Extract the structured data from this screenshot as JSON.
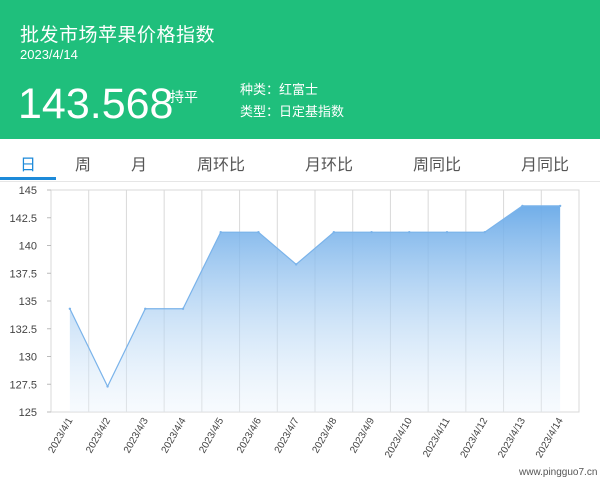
{
  "header": {
    "title": "批发市场苹果价格指数",
    "date": "2023/4/14",
    "value": "143.568",
    "trend": "持平",
    "variety": "种类：红富士",
    "index_type": "类型：日定基指数"
  },
  "tabs": [
    "日",
    "周",
    "月",
    "周环比",
    "月环比",
    "周同比",
    "月同比"
  ],
  "colors": {
    "header_bg": "#1fbf7c",
    "active_tab": "#1d8ad9",
    "line": "#7ab3ea"
  },
  "chart_data": {
    "type": "area",
    "x": [
      "2023/4/1",
      "2023/4/2",
      "2023/4/3",
      "2023/4/4",
      "2023/4/5",
      "2023/4/6",
      "2023/4/7",
      "2023/4/8",
      "2023/4/9",
      "2023/4/10",
      "2023/4/11",
      "2023/4/12",
      "2023/4/13",
      "2023/4/14"
    ],
    "values": [
      134.3,
      127.3,
      134.3,
      134.3,
      141.2,
      141.2,
      138.3,
      141.2,
      141.2,
      141.2,
      141.2,
      141.2,
      143.568,
      143.568
    ],
    "yticks": [
      "125",
      "127.5",
      "130",
      "132.5",
      "135",
      "137.5",
      "140",
      "142.5",
      "145"
    ],
    "ylim": [
      125,
      145
    ],
    "grid": "vertical"
  },
  "watermark": "www.pingguo7.cn"
}
